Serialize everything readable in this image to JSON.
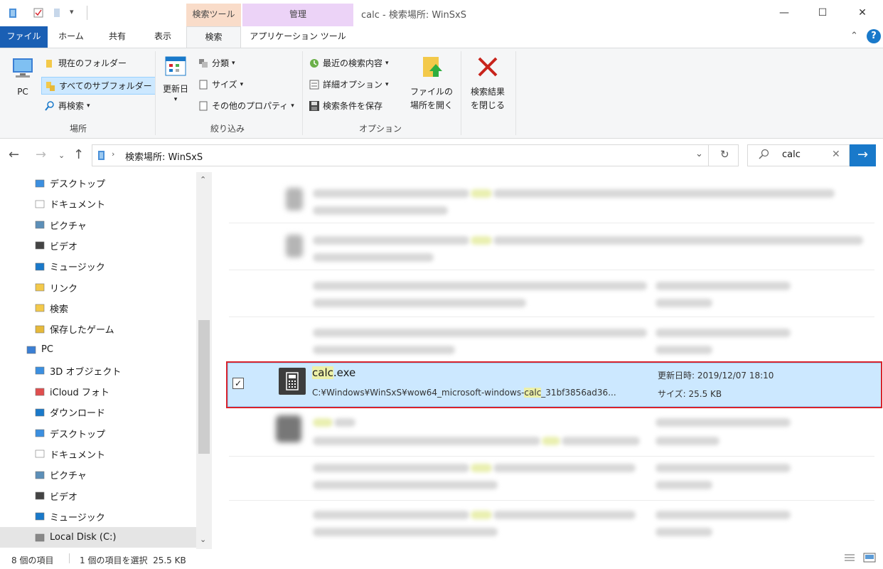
{
  "titlebar": {
    "window_title": "calc - 検索場所: WinSxS",
    "context_tab_search": "検索ツール",
    "context_tab_manage": "管理",
    "minimize": "—",
    "maximize": "☐",
    "close": "✕"
  },
  "tabs": {
    "file": "ファイル",
    "home": "ホーム",
    "share": "共有",
    "view": "表示",
    "search": "検索",
    "app_tools": "アプリケーション ツール"
  },
  "ribbon": {
    "location": {
      "pc": "PC",
      "current_folder": "現在のフォルダー",
      "all_subfolders": "すべてのサブフォルダー",
      "search_again": "再検索",
      "label": "場所"
    },
    "refine": {
      "date_modified": "更新日",
      "kind": "分類",
      "size": "サイズ",
      "other_properties": "その他のプロパティ",
      "label": "絞り込み"
    },
    "options": {
      "recent_searches": "最近の検索内容",
      "advanced_options": "詳細オプション",
      "save_search": "検索条件を保存",
      "open_location_1": "ファイルの",
      "open_location_2": "場所を開く",
      "label": "オプション"
    },
    "close_search_1": "検索結果",
    "close_search_2": "を閉じる"
  },
  "address": {
    "path": "検索場所: WinSxS",
    "search_value": "calc"
  },
  "nav": {
    "items": [
      {
        "label": "デスクトップ",
        "icon": "desktop-icon"
      },
      {
        "label": "ドキュメント",
        "icon": "document-icon"
      },
      {
        "label": "ピクチャ",
        "icon": "pictures-icon"
      },
      {
        "label": "ビデオ",
        "icon": "videos-icon"
      },
      {
        "label": "ミュージック",
        "icon": "music-icon"
      },
      {
        "label": "リンク",
        "icon": "links-icon"
      },
      {
        "label": "検索",
        "icon": "searches-icon"
      },
      {
        "label": "保存したゲーム",
        "icon": "saved-games-icon"
      },
      {
        "label": "PC",
        "icon": "pc-icon"
      },
      {
        "label": "3D オブジェクト",
        "icon": "3d-objects-icon"
      },
      {
        "label": "iCloud フォト",
        "icon": "icloud-photos-icon"
      },
      {
        "label": "ダウンロード",
        "icon": "downloads-icon"
      },
      {
        "label": "デスクトップ",
        "icon": "desktop-icon"
      },
      {
        "label": "ドキュメント",
        "icon": "document-icon"
      },
      {
        "label": "ピクチャ",
        "icon": "pictures-icon"
      },
      {
        "label": "ビデオ",
        "icon": "videos-icon"
      },
      {
        "label": "ミュージック",
        "icon": "music-icon"
      },
      {
        "label": "Local Disk (C:)",
        "icon": "local-disk-icon"
      }
    ]
  },
  "selected_item": {
    "name_highlight": "calc",
    "name_rest": ".exe",
    "path_before": "C:¥Windows¥WinSxS¥wow64_microsoft-windows-",
    "path_highlight": "calc",
    "path_after": "_31bf3856ad36...",
    "date_label": "更新日時: 2019/12/07 18:10",
    "size_label": "サイズ: 25.5 KB"
  },
  "status": {
    "item_count": "8 個の項目",
    "selection": "1 個の項目を選択  25.5 KB"
  },
  "colors": {
    "accent": "#1979ca",
    "file_tab": "#1a5fb4",
    "selection": "#cce8ff",
    "highlight": "#ecf0a8",
    "annotation_box": "#d9232c"
  }
}
